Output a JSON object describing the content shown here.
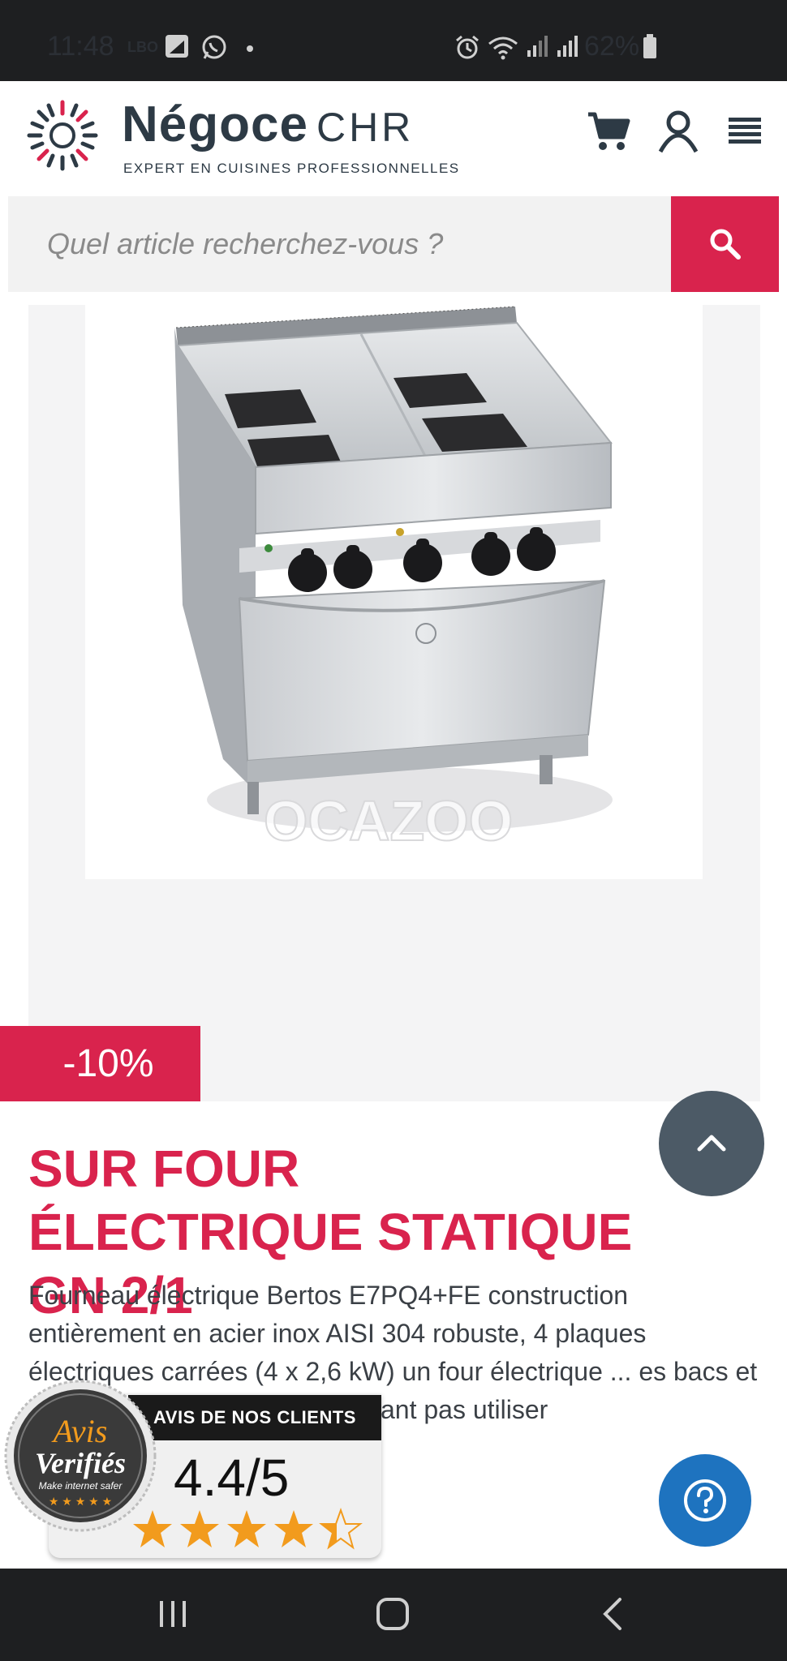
{
  "status_bar": {
    "time": "11:48",
    "carrier": "LBO",
    "battery": "62%",
    "icons": [
      "gallery-icon",
      "whatsapp-icon",
      "dot-icon",
      "alarm-icon",
      "wifi-icon",
      "signal-icon",
      "signal-icon",
      "battery-icon"
    ]
  },
  "header": {
    "brand_bold": "Négoce",
    "brand_light": "CHR",
    "tagline": "EXPERT EN CUISINES PROFESSIONNELLES",
    "icons": [
      "cart-icon",
      "account-icon",
      "menu-icon"
    ]
  },
  "search": {
    "placeholder": "Quel article recherchez-vous ?"
  },
  "product": {
    "discount": "-10%",
    "watermark": "OCAZOO",
    "title": "SUR FOUR ÉLECTRIQUE STATIQUE GN 2/1",
    "description": "Fourneau électrique Bertos E7PQ4+FE construction entièrement en acier inox AISI 304 robuste, 4 plaques électriques carrées (4 x 2,6 kW) un four électrique ... es bacs et grilles GN2/1. ... urant ne pouvant pas utiliser"
  },
  "reviews_badge": {
    "seal_line1": "Avis",
    "seal_line2": "Verifiés",
    "seal_tagline": "Make internet safer",
    "header": "AVIS DE NOS CLIENTS",
    "score": "4.4/5",
    "rating": 4.4
  },
  "colors": {
    "accent": "#d9234d",
    "dark_text": "#2d3a45",
    "to_top_bg": "#4c5a66",
    "help_bg": "#1e73bf"
  },
  "nav_bar": {
    "icons": [
      "recents-icon",
      "home-icon",
      "back-icon"
    ]
  }
}
